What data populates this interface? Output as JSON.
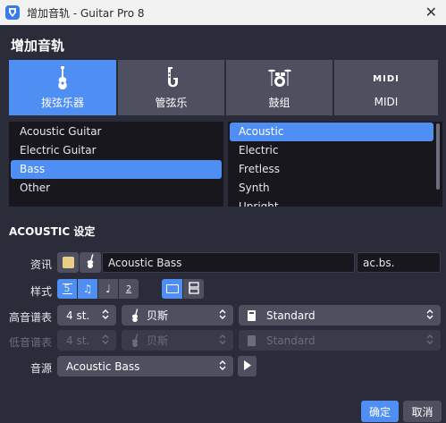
{
  "window": {
    "title": "增加音轨 - Guitar Pro 8",
    "close_glyph": "✕"
  },
  "dialog": {
    "heading": "增加音轨"
  },
  "categories": [
    {
      "label": "拨弦乐器",
      "icon": "guitar-icon",
      "active": true
    },
    {
      "label": "管弦乐",
      "icon": "saxophone-icon",
      "active": false
    },
    {
      "label": "鼓组",
      "icon": "drum-kit-icon",
      "active": false
    },
    {
      "label": "MIDI",
      "icon": "midi-icon",
      "active": false,
      "icon_text": "MIDI"
    }
  ],
  "instrument_list": [
    "Acoustic Guitar",
    "Electric Guitar",
    "Bass",
    "Other"
  ],
  "instrument_selected": "Bass",
  "variant_list": [
    "Acoustic",
    "Electric",
    "Fretless",
    "Synth",
    "Upright"
  ],
  "variant_selected": "Acoustic",
  "settings": {
    "heading": "ACOUSTIC 设定",
    "info_label": "资讯",
    "track_name": "Acoustic Bass",
    "track_short": "ac.bs.",
    "color_swatch": "#e9cf85",
    "style_label": "样式",
    "notation_styles": [
      {
        "glyph": "5",
        "icon": "tab-icon",
        "active": true
      },
      {
        "glyph": "♫",
        "icon": "standard-notation-icon",
        "active": true
      },
      {
        "glyph": "♩",
        "icon": "rhythm-icon",
        "active": false
      },
      {
        "glyph": "2",
        "icon": "slash-icon",
        "active": false
      }
    ],
    "layout_styles": [
      {
        "icon": "single-staff-icon",
        "active": true
      },
      {
        "icon": "multi-staff-icon",
        "active": false
      }
    ],
    "treble_label": "高音谱表",
    "treble_strings": "4 st.",
    "treble_instrument": "贝斯",
    "treble_tuning": "Standard",
    "bass_label": "低音谱表",
    "bass_strings": "4 st.",
    "bass_instrument": "贝斯",
    "bass_tuning": "Standard",
    "sound_label": "音源",
    "sound_value": "Acoustic Bass"
  },
  "buttons": {
    "ok": "确定",
    "cancel": "取消"
  },
  "colors": {
    "accent": "#4f8ef2",
    "background": "#2b2c39",
    "panel": "#4e5060",
    "list_bg": "#17171d"
  }
}
